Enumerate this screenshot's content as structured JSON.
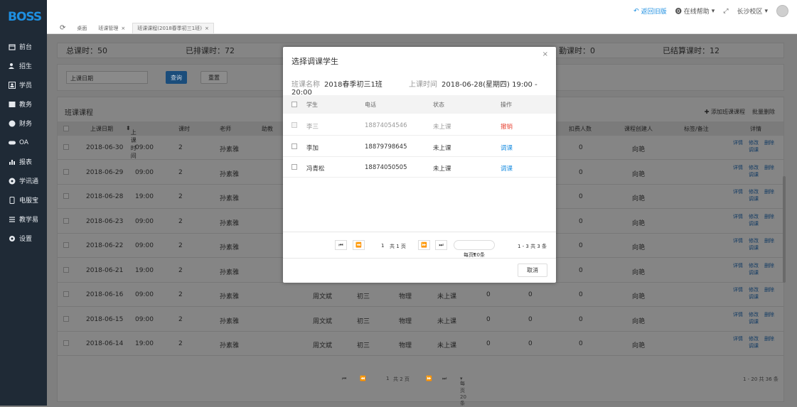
{
  "logo": "BOSS",
  "sidebar": {
    "items": [
      {
        "label": "前台",
        "icon": "calendar-icon"
      },
      {
        "label": "招生",
        "icon": "users-icon"
      },
      {
        "label": "学员",
        "icon": "student-icon"
      },
      {
        "label": "教务",
        "icon": "book-icon"
      },
      {
        "label": "财务",
        "icon": "money-icon"
      },
      {
        "label": "OA",
        "icon": "toggle-icon"
      },
      {
        "label": "报表",
        "icon": "chart-icon"
      },
      {
        "label": "学讯通",
        "icon": "location-icon"
      },
      {
        "label": "电服宝",
        "icon": "phone-icon"
      },
      {
        "label": "教学易",
        "icon": "teaching-icon"
      },
      {
        "label": "设置",
        "icon": "gear-icon"
      }
    ]
  },
  "topbar": {
    "back": "返回旧版",
    "help": "在线帮助",
    "campus": "长沙校区"
  },
  "tabs": [
    "桌面",
    "班课管理",
    "班课课程(2018春季初三1班)"
  ],
  "stats": {
    "total": "总课时：50",
    "scheduled": "已排课时：72",
    "attendance": "勤课时：0",
    "settled": "已结算课时：12"
  },
  "filter": {
    "date_placeholder": "上课日期",
    "query": "查询",
    "reset": "重置"
  },
  "list": {
    "title": "班课课程",
    "add": "添加班课课程",
    "batch_delete": "批量删除",
    "headers": {
      "date": "上课日期",
      "time": "上课时间",
      "hours": "课时",
      "teacher": "老师",
      "assistant": "助教",
      "deduct": "扣费人数",
      "creator": "课程创建人",
      "tags": "标签/备注",
      "detail": "详情"
    },
    "ops": {
      "detail": "详情",
      "edit": "修改",
      "delete": "删除",
      "adjust": "调课"
    },
    "rows": [
      {
        "date": "2018-06-30",
        "time": "09:00",
        "hours": "2",
        "teacher": "孙素雅",
        "deduct": "0",
        "creator": "向艳"
      },
      {
        "date": "2018-06-29",
        "time": "09:00",
        "hours": "2",
        "teacher": "孙素雅",
        "deduct": "0",
        "creator": "向艳"
      },
      {
        "date": "2018-06-28",
        "time": "19:00",
        "hours": "2",
        "teacher": "孙素雅",
        "deduct": "0",
        "creator": "向艳"
      },
      {
        "date": "2018-06-23",
        "time": "09:00",
        "hours": "2",
        "teacher": "孙素雅",
        "deduct": "0",
        "creator": "向艳"
      },
      {
        "date": "2018-06-22",
        "time": "09:00",
        "hours": "2",
        "teacher": "孙素雅",
        "deduct": "0",
        "creator": "向艳"
      },
      {
        "date": "2018-06-21",
        "time": "19:00",
        "hours": "2",
        "teacher": "孙素雅",
        "deduct": "0",
        "creator": "向艳"
      },
      {
        "date": "2018-06-16",
        "time": "09:00",
        "hours": "2",
        "teacher": "孙素雅",
        "head": "周文斌",
        "grade": "初三",
        "subject": "物理",
        "status": "未上课",
        "n1": "0",
        "n2": "0",
        "deduct": "0",
        "creator": "向艳"
      },
      {
        "date": "2018-06-15",
        "time": "09:00",
        "hours": "2",
        "teacher": "孙素雅",
        "head": "周文斌",
        "grade": "初三",
        "subject": "物理",
        "status": "未上课",
        "n1": "0",
        "n2": "0",
        "deduct": "0",
        "creator": "向艳"
      },
      {
        "date": "2018-06-14",
        "time": "19:00",
        "hours": "2",
        "teacher": "孙素雅",
        "head": "周文斌",
        "grade": "初三",
        "subject": "物理",
        "status": "未上课",
        "n1": "0",
        "n2": "0",
        "deduct": "0",
        "creator": "向艳"
      }
    ],
    "pager": {
      "page": "1",
      "of": "共 2 页",
      "per_page": "每页20条",
      "range": "1 - 20  共 36 条"
    }
  },
  "modal": {
    "title": "选择调课学生",
    "class_label": "班课名称",
    "class_name": "2018春季初三1班",
    "time_label": "上课时间",
    "time_value": "2018-06-28(星期四) 19:00 - 20:00",
    "headers": {
      "student": "学生",
      "phone": "电话",
      "status": "状态",
      "action": "操作"
    },
    "rows": [
      {
        "student": "李三",
        "phone": "18874054546",
        "status": "未上课",
        "action": "撤销"
      },
      {
        "student": "李加",
        "phone": "18879798645",
        "status": "未上课",
        "action": "调课"
      },
      {
        "student": "冯青松",
        "phone": "18874050505",
        "status": "未上课",
        "action": "调课"
      }
    ],
    "pager": {
      "page": "1",
      "of": "共 1 页",
      "per_page": "每页20条",
      "range": "1 - 3  共 3 条"
    },
    "cancel": "取消"
  },
  "colors": {
    "accent": "#1e8fe1",
    "danger": "#e84c3d",
    "sidebar": "#1f2a36"
  }
}
